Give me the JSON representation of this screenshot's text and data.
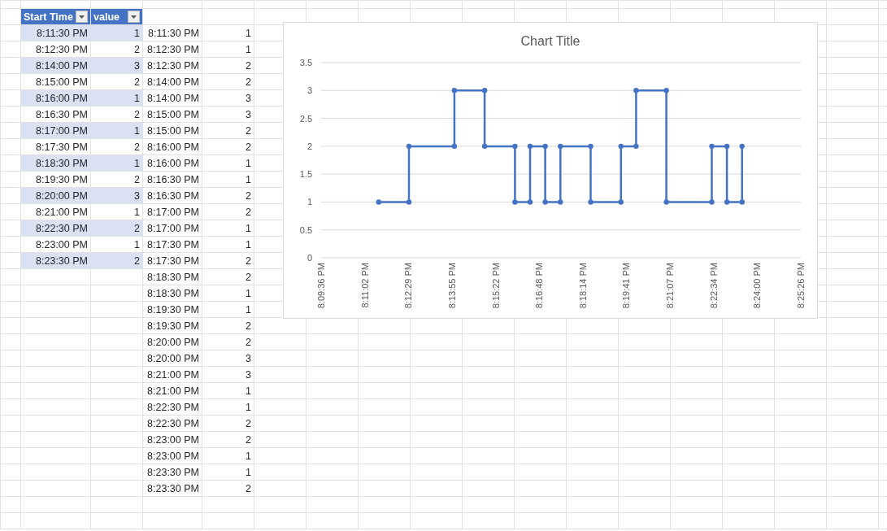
{
  "table": {
    "columns": [
      {
        "label": "Start Time"
      },
      {
        "label": "value"
      }
    ],
    "rows": [
      {
        "start_time": "8:11:30 PM",
        "value": "1"
      },
      {
        "start_time": "8:12:30 PM",
        "value": "2"
      },
      {
        "start_time": "8:14:00 PM",
        "value": "3"
      },
      {
        "start_time": "8:15:00 PM",
        "value": "2"
      },
      {
        "start_time": "8:16:00 PM",
        "value": "1"
      },
      {
        "start_time": "8:16:30 PM",
        "value": "2"
      },
      {
        "start_time": "8:17:00 PM",
        "value": "1"
      },
      {
        "start_time": "8:17:30 PM",
        "value": "2"
      },
      {
        "start_time": "8:18:30 PM",
        "value": "1"
      },
      {
        "start_time": "8:19:30 PM",
        "value": "2"
      },
      {
        "start_time": "8:20:00 PM",
        "value": "3"
      },
      {
        "start_time": "8:21:00 PM",
        "value": "1"
      },
      {
        "start_time": "8:22:30 PM",
        "value": "2"
      },
      {
        "start_time": "8:23:00 PM",
        "value": "1"
      },
      {
        "start_time": "8:23:30 PM",
        "value": "2"
      }
    ]
  },
  "step_list": [
    {
      "time": "8:11:30 PM",
      "value": "1"
    },
    {
      "time": "8:12:30 PM",
      "value": "1"
    },
    {
      "time": "8:12:30 PM",
      "value": "2"
    },
    {
      "time": "8:14:00 PM",
      "value": "2"
    },
    {
      "time": "8:14:00 PM",
      "value": "3"
    },
    {
      "time": "8:15:00 PM",
      "value": "3"
    },
    {
      "time": "8:15:00 PM",
      "value": "2"
    },
    {
      "time": "8:16:00 PM",
      "value": "2"
    },
    {
      "time": "8:16:00 PM",
      "value": "1"
    },
    {
      "time": "8:16:30 PM",
      "value": "1"
    },
    {
      "time": "8:16:30 PM",
      "value": "2"
    },
    {
      "time": "8:17:00 PM",
      "value": "2"
    },
    {
      "time": "8:17:00 PM",
      "value": "1"
    },
    {
      "time": "8:17:30 PM",
      "value": "1"
    },
    {
      "time": "8:17:30 PM",
      "value": "2"
    },
    {
      "time": "8:18:30 PM",
      "value": "2"
    },
    {
      "time": "8:18:30 PM",
      "value": "1"
    },
    {
      "time": "8:19:30 PM",
      "value": "1"
    },
    {
      "time": "8:19:30 PM",
      "value": "2"
    },
    {
      "time": "8:20:00 PM",
      "value": "2"
    },
    {
      "time": "8:20:00 PM",
      "value": "3"
    },
    {
      "time": "8:21:00 PM",
      "value": "3"
    },
    {
      "time": "8:21:00 PM",
      "value": "1"
    },
    {
      "time": "8:22:30 PM",
      "value": "1"
    },
    {
      "time": "8:22:30 PM",
      "value": "2"
    },
    {
      "time": "8:23:00 PM",
      "value": "2"
    },
    {
      "time": "8:23:00 PM",
      "value": "1"
    },
    {
      "time": "8:23:30 PM",
      "value": "1"
    },
    {
      "time": "8:23:30 PM",
      "value": "2"
    }
  ],
  "chart": {
    "chart_data": {
      "type": "line",
      "title": "Chart Title",
      "x": [
        72690,
        72750,
        72750,
        72840,
        72840,
        72900,
        72900,
        72960,
        72960,
        72990,
        72990,
        73020,
        73020,
        73050,
        73050,
        73110,
        73110,
        73170,
        73170,
        73200,
        73200,
        73260,
        73260,
        73350,
        73350,
        73380,
        73380,
        73410,
        73410
      ],
      "series": [
        {
          "color": "#4472c4",
          "marker": "circle",
          "values": [
            1,
            1,
            2,
            2,
            3,
            3,
            2,
            2,
            1,
            1,
            2,
            2,
            1,
            1,
            2,
            2,
            1,
            1,
            2,
            2,
            3,
            3,
            1,
            1,
            2,
            2,
            1,
            1,
            2
          ]
        }
      ],
      "xlim": [
        72576,
        73526.4
      ],
      "ylim": [
        0,
        3.5
      ],
      "xticks": [
        {
          "value": 72576,
          "label": "8:09:36 PM"
        },
        {
          "value": 72662.4,
          "label": "8:11:02 PM"
        },
        {
          "value": 72748.8,
          "label": "8:12:29 PM"
        },
        {
          "value": 72835.2,
          "label": "8:13:55 PM"
        },
        {
          "value": 72921.6,
          "label": "8:15:22 PM"
        },
        {
          "value": 73008,
          "label": "8:16:48 PM"
        },
        {
          "value": 73094.4,
          "label": "8:18:14 PM"
        },
        {
          "value": 73180.8,
          "label": "8:19:41 PM"
        },
        {
          "value": 73267.2,
          "label": "8:21:07 PM"
        },
        {
          "value": 73353.6,
          "label": "8:22:34 PM"
        },
        {
          "value": 73440,
          "label": "8:24:00 PM"
        },
        {
          "value": 73526.4,
          "label": "8:25:26 PM"
        }
      ],
      "yticks": [
        0,
        0.5,
        1,
        1.5,
        2,
        2.5,
        3,
        3.5
      ],
      "grid": true
    }
  }
}
